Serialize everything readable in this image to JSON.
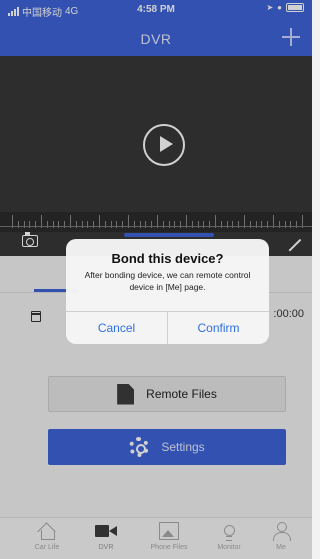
{
  "status": {
    "carrier": "中国移动",
    "network": "4G",
    "time": "4:58 PM"
  },
  "nav": {
    "title": "DVR",
    "add_icon": "plus-icon"
  },
  "player": {
    "play_icon": "play-icon",
    "snapshot_icon": "camera-icon",
    "fullscreen_icon": "fullscreen-icon"
  },
  "playback": {
    "time_fragment": ":00:00"
  },
  "actions": {
    "remote_files_label": "Remote Files",
    "settings_label": "Settings"
  },
  "tabs": [
    {
      "label": "Car Life",
      "icon": "home-icon"
    },
    {
      "label": "DVR",
      "icon": "video-camera-icon"
    },
    {
      "label": "Phone Files",
      "icon": "image-icon"
    },
    {
      "label": "Monitor",
      "icon": "lightbulb-icon"
    },
    {
      "label": "Me",
      "icon": "user-icon"
    }
  ],
  "dialog": {
    "title": "Bond this device?",
    "message": "After bonding device, we can remote control device in [Me] page.",
    "cancel_label": "Cancel",
    "confirm_label": "Confirm"
  },
  "colors": {
    "brand_blue": "#3e63d8",
    "video_bg": "#373737",
    "dialog_link": "#2f6fe0"
  }
}
